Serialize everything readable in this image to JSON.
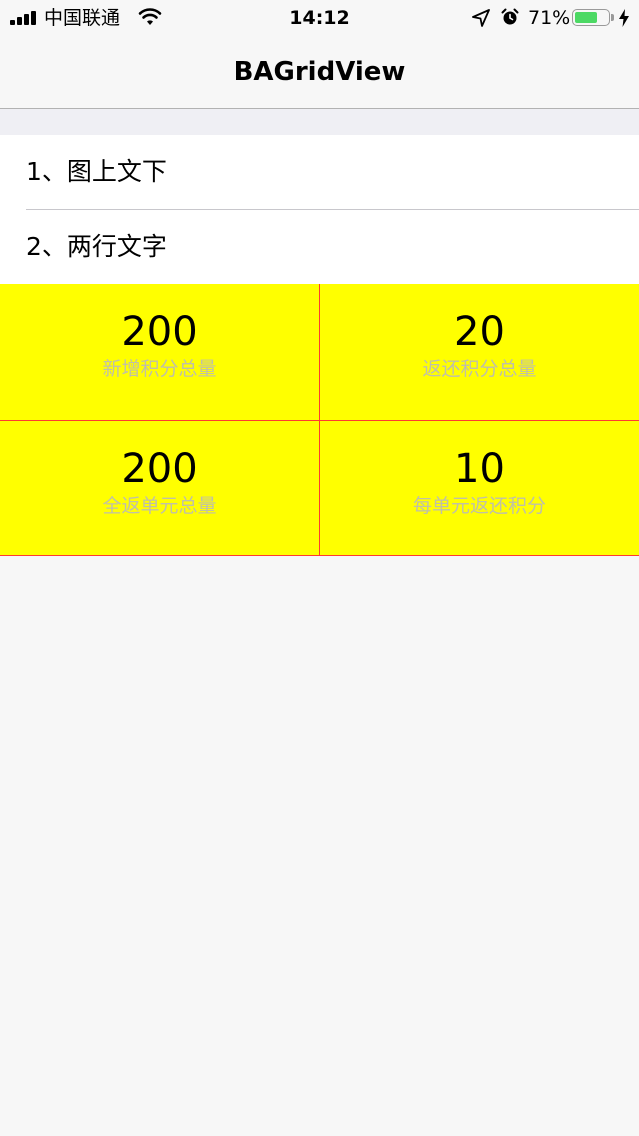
{
  "status_bar": {
    "carrier": "中国联通",
    "time": "14:12",
    "battery_percent": "71%",
    "battery_level": 0.71,
    "battery_color": "#4cd964",
    "icons": [
      "signal-bars-icon",
      "wifi-icon",
      "location-arrow-icon",
      "alarm-clock-icon",
      "battery-icon",
      "charging-bolt-icon"
    ]
  },
  "nav": {
    "title": "BAGridView"
  },
  "list": {
    "items": [
      {
        "label": "1、图上文下"
      },
      {
        "label": "2、两行文字"
      }
    ]
  },
  "grid": {
    "background": "#ffff00",
    "divider_color": "#ff3b30",
    "label_color": "#c0c0a8",
    "cells": [
      {
        "value": "200",
        "label": "新增积分总量"
      },
      {
        "value": "20",
        "label": "返还积分总量"
      },
      {
        "value": "200",
        "label": "全返单元总量"
      },
      {
        "value": "10",
        "label": "每单元返还积分"
      }
    ]
  }
}
